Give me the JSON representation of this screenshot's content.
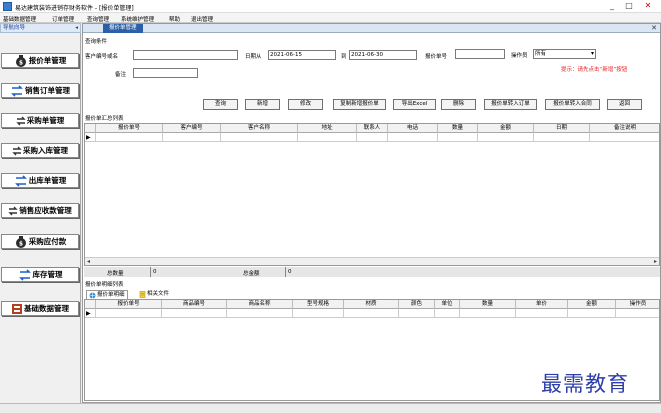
{
  "window": {
    "title": "易达建筑装饰进销存财务软件 - [报价单管理]",
    "controls": {
      "minimize": "_",
      "maximize": "□",
      "close": "✕"
    }
  },
  "menu": [
    "基础数据管理",
    "订单管理",
    "查询管理",
    "系统维护管理",
    "帮助",
    "退出管理"
  ],
  "nav": {
    "header": "导航向导",
    "collapse": "◂",
    "items": [
      {
        "label": "报价单管理",
        "icon": "money-bag-icon"
      },
      {
        "label": "销售订单管理",
        "icon": "transfer-arrows-icon"
      },
      {
        "label": "采购单管理",
        "icon": "exchange-icon"
      },
      {
        "label": "采购入库管理",
        "icon": "exchange-icon"
      },
      {
        "label": "出库单管理",
        "icon": "transfer-arrows-icon"
      },
      {
        "label": "销售应收款管理",
        "icon": "exchange-icon"
      },
      {
        "label": "采购应付款",
        "icon": "money-bag-icon"
      },
      {
        "label": "库存管理",
        "icon": "transfer-arrows-icon"
      },
      {
        "label": "基础数据管理",
        "icon": "database-icon"
      }
    ]
  },
  "tab": {
    "label": "报价单管理",
    "close": "✕"
  },
  "query": {
    "section_label": "查询条件",
    "customer_label": "客户编号或名",
    "customer_value": "",
    "date_label": "日期从",
    "date_from": "2021-06-15",
    "date_to_label": "到",
    "date_to": "2021-06-30",
    "quote_no_label": "报价单号",
    "quote_no_value": "",
    "operator_label": "操作员",
    "operator_value": "所有",
    "remark_label": "备注",
    "remark_value": "",
    "hint": "提示：请先点击“新增”按钮"
  },
  "buttons": [
    "查询",
    "新增",
    "修改",
    "复制新增报价单",
    "导出Excel",
    "删除",
    "报价单转入订单",
    "报价单转入合同",
    "返回"
  ],
  "summary_grid": {
    "section_label": "报价单汇总列表",
    "columns": [
      "报价单号",
      "客户编号",
      "客户名称",
      "地址",
      "联系人",
      "电话",
      "数量",
      "金额",
      "日期",
      "备注说明"
    ]
  },
  "totals": {
    "count_label": "总数量",
    "count_value": "0",
    "amount_label": "总金额",
    "amount_value": "0"
  },
  "detail": {
    "section_label": "报价单明细列表",
    "tabs": [
      {
        "label": "报价单明细",
        "icon": "globe-icon"
      },
      {
        "label": "相关文件",
        "icon": "document-icon"
      }
    ],
    "columns": [
      "报价单号",
      "商品编号",
      "商品名称",
      "型号规格",
      "材质",
      "颜色",
      "单位",
      "数量",
      "单价",
      "金额",
      "操作员"
    ]
  },
  "watermark": "最需教育"
}
